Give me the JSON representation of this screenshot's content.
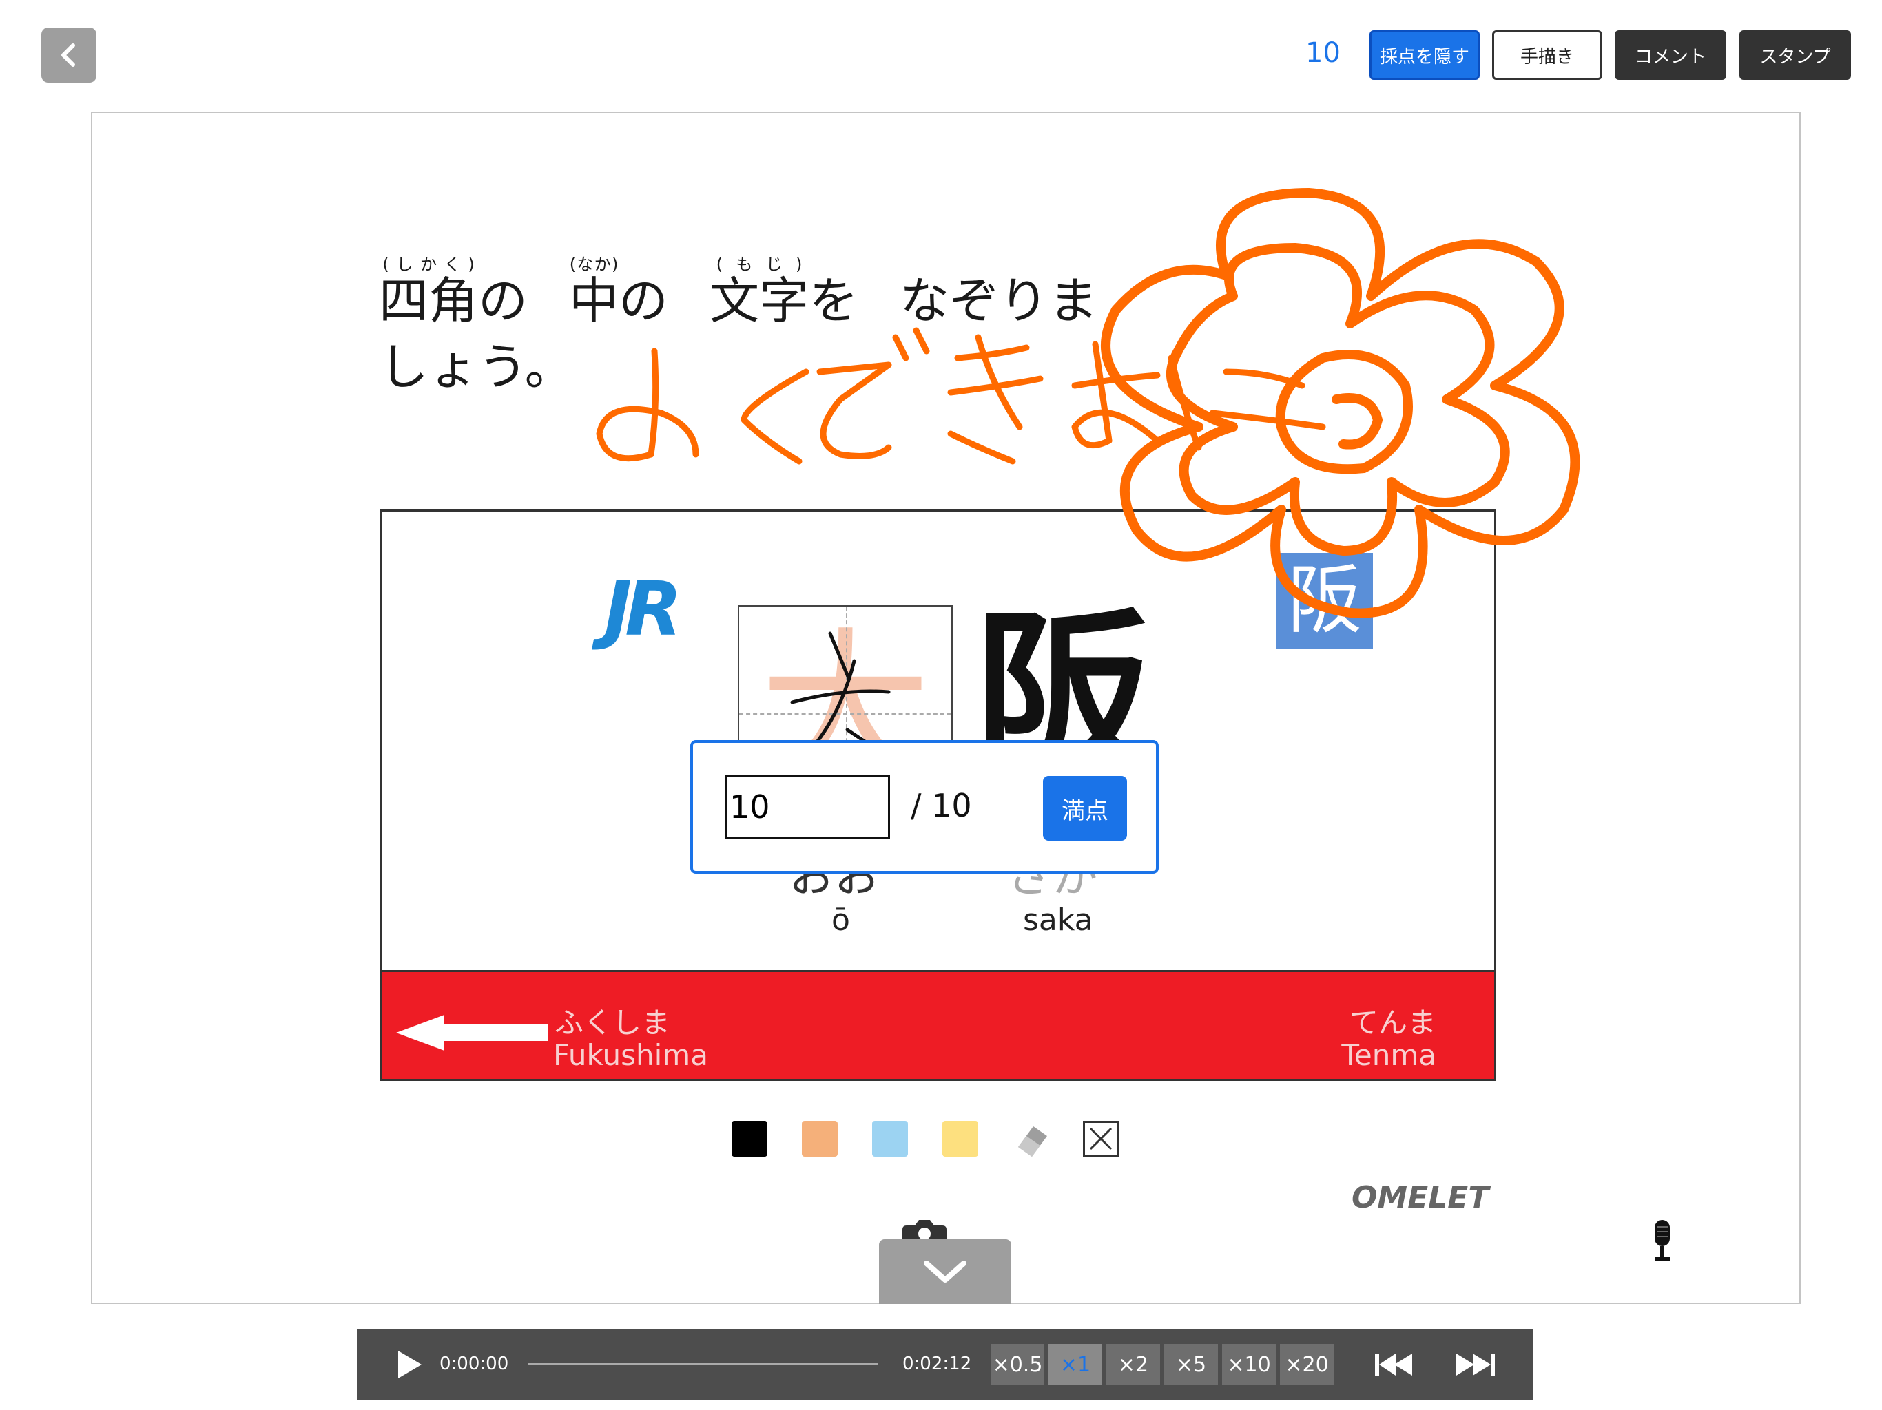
{
  "toolbar": {
    "score": "10",
    "hide_scoring_label": "採点を隠す",
    "handwriting_label": "手描き",
    "comment_label": "コメント",
    "stamp_label": "スタンプ"
  },
  "instruction": {
    "w1": "四角",
    "r1": "(しかく)",
    "p1": "の",
    "w2": "中",
    "r2": "(なか)",
    "p2": "の",
    "w3": "文字",
    "r3": "(もじ)",
    "p3": "を",
    "tail1": "なぞりま",
    "tail2": "しょう。"
  },
  "station_sign": {
    "logo": "JR",
    "guide_char": "大",
    "char2": "阪",
    "badge_char": "阪",
    "kana1": "おお",
    "kana2": "さか",
    "roman1": "ō",
    "roman2": "saka",
    "prev_station_kana": "ふくしま",
    "prev_station_roman": "Fukushima",
    "next_station_kana": "てんま",
    "next_station_roman": "Tenma"
  },
  "score_popup": {
    "input_value": "10",
    "total": "/  10",
    "perfect_label": "満点"
  },
  "palette": {
    "colors": [
      "#000000",
      "#f5b07a",
      "#9cd3f2",
      "#fde07f"
    ]
  },
  "handwriting_text": "よくできました",
  "brand": "OMELET",
  "player": {
    "current_time": "0:00:00",
    "total_time": "0:02:12",
    "speeds": [
      "×0.5",
      "×1",
      "×2",
      "×5",
      "×10",
      "×20"
    ],
    "active_speed": "×1"
  },
  "colors": {
    "accent": "#1a73e8",
    "ink_orange": "#ff6a00",
    "band_red": "#ee1c25"
  }
}
